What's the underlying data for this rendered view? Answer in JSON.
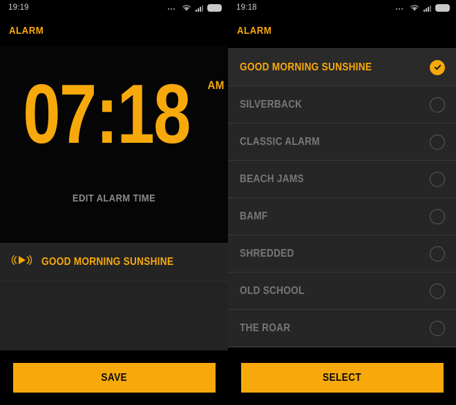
{
  "left_panel": {
    "statusbar": {
      "time": "19:19",
      "icons": [
        "more-dots-icon",
        "wifi-icon",
        "signal-icon",
        "battery-icon"
      ]
    },
    "header": {
      "title": "ALARM"
    },
    "clock": {
      "time": "07:18",
      "hours": "07",
      "minutes": "18",
      "meridiem": "AM",
      "edit_label": "EDIT ALARM TIME"
    },
    "sound_row": {
      "icon": "sound-play-icon",
      "label": "GOOD MORNING SUNSHINE"
    },
    "button": {
      "label": "SAVE"
    }
  },
  "right_panel": {
    "statusbar": {
      "time": "19:18",
      "icons": [
        "more-dots-icon",
        "wifi-icon",
        "signal-icon",
        "battery-icon"
      ]
    },
    "header": {
      "title": "ALARM"
    },
    "sound_list": [
      {
        "label": "GOOD MORNING SUNSHINE",
        "selected": true
      },
      {
        "label": "SILVERBACK",
        "selected": false
      },
      {
        "label": "CLASSIC ALARM",
        "selected": false
      },
      {
        "label": "BEACH JAMS",
        "selected": false
      },
      {
        "label": "BAMF",
        "selected": false
      },
      {
        "label": "SHREDDED",
        "selected": false
      },
      {
        "label": "OLD SCHOOL",
        "selected": false
      },
      {
        "label": "THE ROAR",
        "selected": false
      }
    ],
    "button": {
      "label": "SELECT"
    }
  },
  "colors": {
    "accent": "#f7a90b",
    "background": "#000000",
    "panel": "#232323",
    "row": "#262626",
    "row_selected": "#2a2a2a",
    "divider": "#3a3a3a",
    "muted_text": "#77777a"
  }
}
